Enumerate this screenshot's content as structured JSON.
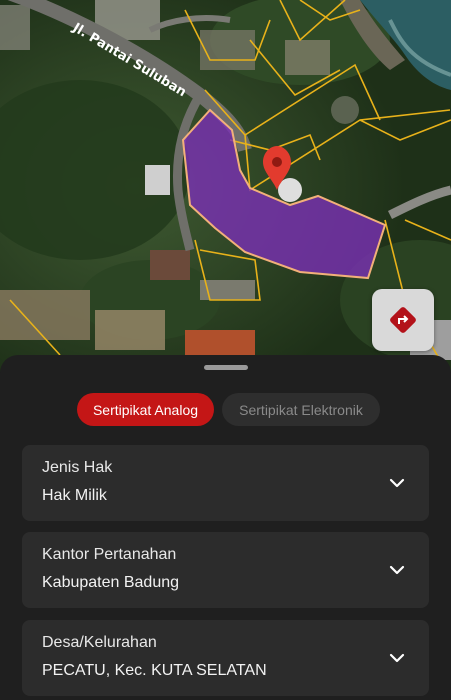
{
  "map": {
    "road_label": "Jl. Pantai Suluban",
    "marker_icon": "map-pin-icon",
    "directions_icon": "directions-icon",
    "parcel_color": "#7c2fb8",
    "boundary_color": "#e8b21a"
  },
  "tabs": {
    "active_label": "Sertipikat Analog",
    "inactive_label": "Sertipikat Elektronik"
  },
  "fields": [
    {
      "label": "Jenis Hak",
      "value": "Hak Milik"
    },
    {
      "label": "Kantor Pertanahan",
      "value": "Kabupaten Badung"
    },
    {
      "label": "Desa/Kelurahan",
      "value": "PECATU, Kec. KUTA SELATAN"
    }
  ],
  "colors": {
    "accent": "#c41616",
    "sheet": "#1f1f1f",
    "card": "#2c2c2c"
  }
}
